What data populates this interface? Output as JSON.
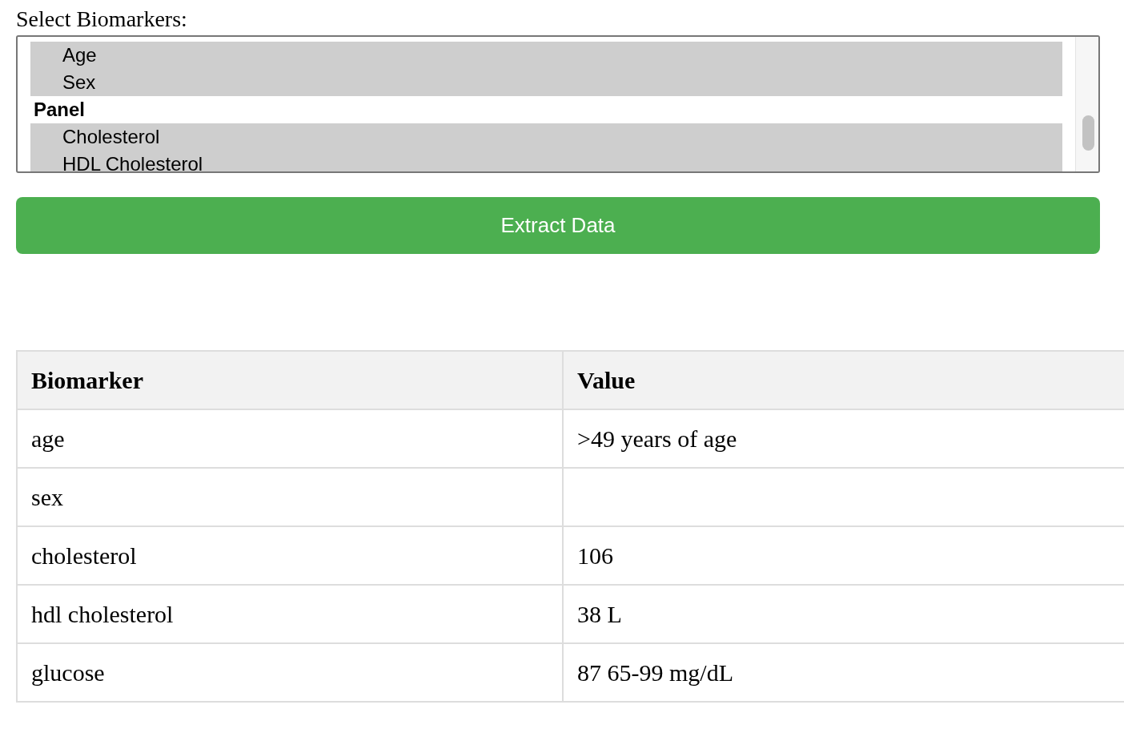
{
  "select_label": "Select Biomarkers:",
  "listbox": {
    "items": [
      {
        "kind": "option",
        "label": "Age",
        "selected": true
      },
      {
        "kind": "option",
        "label": "Sex",
        "selected": true
      },
      {
        "kind": "group",
        "label": "Panel"
      },
      {
        "kind": "option",
        "label": "Cholesterol",
        "selected": true
      },
      {
        "kind": "option",
        "label": "HDL Cholesterol",
        "selected": true
      }
    ]
  },
  "extract_button": "Extract Data",
  "table": {
    "columns": [
      "Biomarker",
      "Value"
    ],
    "rows": [
      {
        "biomarker": "age",
        "value": ">49 years of age"
      },
      {
        "biomarker": "sex"
      },
      {
        "biomarker": "cholesterol",
        "value": "106"
      },
      {
        "biomarker": "hdl cholesterol",
        "value": "38 L"
      },
      {
        "biomarker": "glucose",
        "value": "87 65-99 mg/dL"
      }
    ]
  }
}
